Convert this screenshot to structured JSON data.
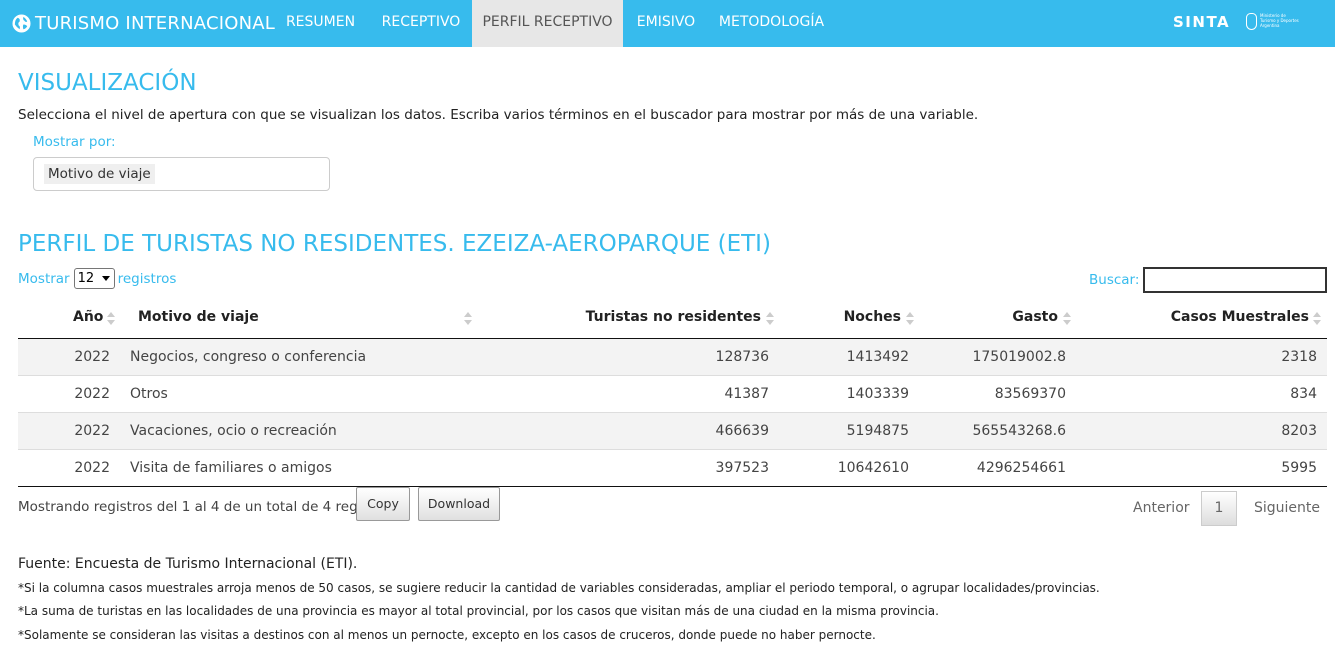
{
  "navbar": {
    "brand": "TURISMO INTERNACIONAL",
    "tabs": [
      "RESUMEN",
      "RECEPTIVO",
      "PERFIL RECEPTIVO",
      "EMISIVO",
      "METODOLOGÍA"
    ],
    "active_tab": "PERFIL RECEPTIVO",
    "sinta": "SINTA",
    "ministry_lines": [
      "Ministerio de",
      "Turismo y Deportes",
      "Argentina"
    ],
    "accent_color": "#37bbed"
  },
  "visualization": {
    "title": "VISUALIZACIÓN",
    "description": "Selecciona el nivel de apertura con que se visualizan los datos. Escriba varios términos en el buscador para mostrar por más de una variable.",
    "show_by_label": "Mostrar por:",
    "selected_chip": "Motivo de viaje"
  },
  "table_section": {
    "title": "PERFIL DE TURISTAS NO RESIDENTES. EZEIZA-AEROPARQUE (ETI)",
    "length_prefix": "Mostrar",
    "length_value": "12",
    "length_suffix": "registros",
    "search_label": "Buscar:",
    "search_value": ""
  },
  "table": {
    "headers": [
      "Año",
      "Motivo de viaje",
      "Turistas no residentes",
      "Noches",
      "Gasto",
      "Casos Muestrales"
    ],
    "rows": [
      [
        "2022",
        "Negocios, congreso o conferencia",
        "128736",
        "1413492",
        "175019002.8",
        "2318"
      ],
      [
        "2022",
        "Otros",
        "41387",
        "1403339",
        "83569370",
        "834"
      ],
      [
        "2022",
        "Vacaciones, ocio o recreación",
        "466639",
        "5194875",
        "565543268.6",
        "8203"
      ],
      [
        "2022",
        "Visita de familiares o amigos",
        "397523",
        "10642610",
        "4296254661",
        "5995"
      ]
    ]
  },
  "table_footer": {
    "info": "Mostrando registros del 1 al 4 de un total de 4 registros",
    "copy_label": "Copy",
    "download_label": "Download",
    "prev_label": "Anterior",
    "page": "1",
    "next_label": "Siguiente"
  },
  "notes": {
    "source": "Fuente: Encuesta de Turismo Internacional (ETI).",
    "lines": [
      "*Si la columna casos muestrales arroja menos de 50 casos, se sugiere reducir la cantidad de variables consideradas, ampliar el periodo temporal, o agrupar localidades/provincias.",
      "*La suma de turistas en las localidades de una provincia es mayor al total provincial, por los casos que visitan más de una ciudad en la misma provincia.",
      "*Solamente se consideran las visitas a destinos con al menos un pernocte, excepto en los casos de cruceros, donde puede no haber pernocte."
    ]
  }
}
